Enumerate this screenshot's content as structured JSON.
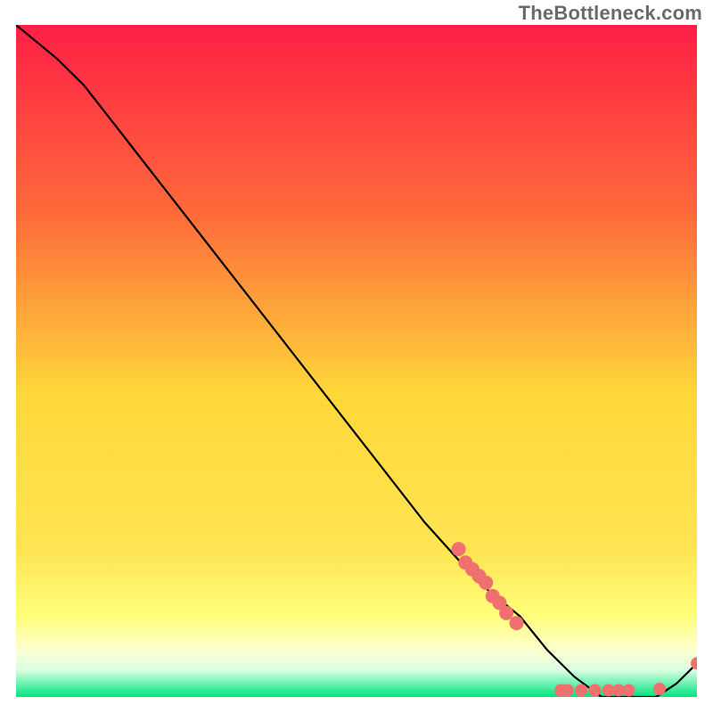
{
  "watermark": "TheBottleneck.com",
  "chart_data": {
    "type": "line",
    "title": "",
    "xlabel": "",
    "ylabel": "",
    "xlim": [
      0,
      100
    ],
    "ylim": [
      0,
      100
    ],
    "background_gradient": {
      "top": "#ff1f46",
      "upper_mid": "#ff8a3a",
      "mid": "#ffd83a",
      "lower_mid": "#ffff62",
      "band_pale": "#ffffde",
      "bottom": "#00e47f"
    },
    "series": [
      {
        "name": "bottleneck-curve",
        "x": [
          0,
          6,
          10,
          20,
          30,
          40,
          50,
          60,
          68,
          74,
          78,
          82,
          86,
          90,
          94,
          97,
          100
        ],
        "y": [
          100,
          95,
          91,
          78,
          65,
          52,
          39,
          26,
          17,
          12,
          7,
          3,
          0,
          0,
          0,
          2,
          5
        ],
        "color": "#000000",
        "width": 2.2
      }
    ],
    "points": [
      {
        "name": "cluster-upper",
        "color": "#f07070",
        "r": 8,
        "xy": [
          [
            65,
            22
          ],
          [
            66,
            20
          ],
          [
            67,
            19
          ],
          [
            68,
            18
          ],
          [
            69,
            17
          ],
          [
            70,
            15
          ],
          [
            71,
            14
          ],
          [
            72,
            12.5
          ],
          [
            73.5,
            11
          ]
        ]
      },
      {
        "name": "cluster-lower",
        "color": "#f07070",
        "r": 7,
        "xy": [
          [
            80,
            1
          ],
          [
            81,
            1
          ],
          [
            83,
            1
          ],
          [
            85,
            1
          ],
          [
            87,
            1
          ],
          [
            88.5,
            1
          ],
          [
            90,
            1
          ],
          [
            94.5,
            1.2
          ]
        ]
      },
      {
        "name": "tail-point",
        "color": "#f07070",
        "r": 7,
        "xy": [
          [
            100,
            5
          ]
        ]
      }
    ]
  }
}
